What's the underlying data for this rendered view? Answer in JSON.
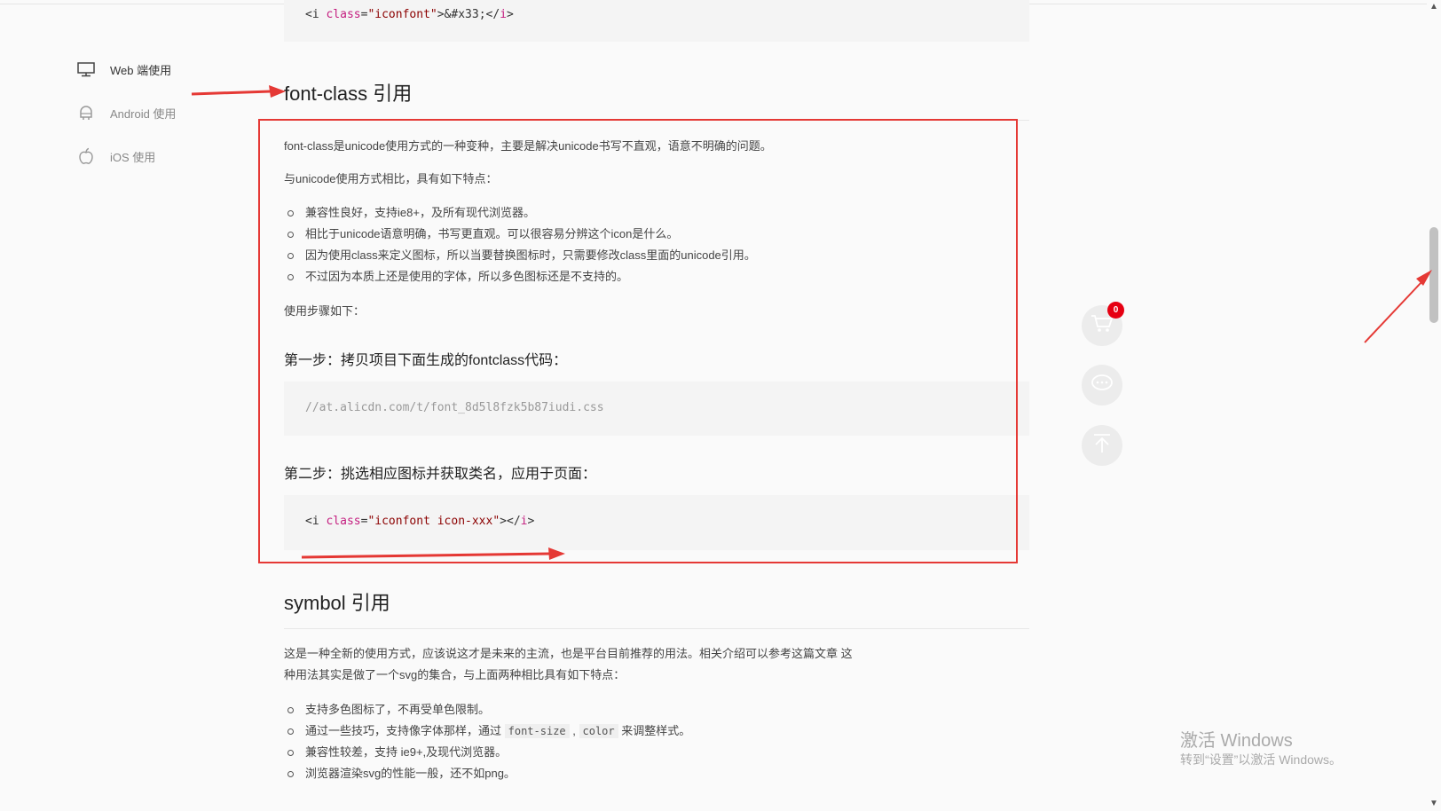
{
  "sidebar": {
    "items": [
      {
        "label": "Web 端使用",
        "icon": "monitor-icon",
        "active": true
      },
      {
        "label": "Android 使用",
        "icon": "android-icon",
        "active": false
      },
      {
        "label": "iOS 使用",
        "icon": "apple-icon",
        "active": false
      }
    ]
  },
  "top_code": {
    "tag_open": "<i ",
    "attr": "class",
    "eq": "=",
    "val": "\"iconfont\"",
    "rest": ">&#x33;</",
    "tag_close": "i",
    "end": ">"
  },
  "font_class": {
    "title": "font-class 引用",
    "intro": "font-class是unicode使用方式的一种变种，主要是解决unicode书写不直观，语意不明确的问题。",
    "compare": "与unicode使用方式相比，具有如下特点：",
    "features": [
      "兼容性良好，支持ie8+，及所有现代浏览器。",
      "相比于unicode语意明确，书写更直观。可以很容易分辨这个icon是什么。",
      "因为使用class来定义图标，所以当要替换图标时，只需要修改class里面的unicode引用。",
      "不过因为本质上还是使用的字体，所以多色图标还是不支持的。"
    ],
    "steps_intro": "使用步骤如下：",
    "step1": "第一步：拷贝项目下面生成的fontclass代码：",
    "step1_code": "//at.alicdn.com/t/font_8d5l8fzk5b87iudi.css",
    "step2": "第二步：挑选相应图标并获取类名，应用于页面：",
    "step2_code": {
      "tag_open": "<i ",
      "attr": "class",
      "eq": "=",
      "val": "\"iconfont icon-xxx\"",
      "rest": "></",
      "tag_close": "i",
      "end": ">"
    }
  },
  "symbol": {
    "title": "symbol 引用",
    "intro_line1": "这是一种全新的使用方式，应该说这才是未来的主流，也是平台目前推荐的用法。相关介绍可以参考这篇文章 这",
    "intro_line2": "种用法其实是做了一个svg的集合，与上面两种相比具有如下特点：",
    "features": [
      {
        "text": "支持多色图标了，不再受单色限制。"
      },
      {
        "pre": "通过一些技巧，支持像字体那样，通过 ",
        "code1": "font-size",
        "mid": " , ",
        "code2": "color",
        "post": " 来调整样式。"
      },
      {
        "text": "兼容性较差，支持 ie9+,及现代浏览器。"
      },
      {
        "text": "浏览器渲染svg的性能一般，还不如png。"
      }
    ]
  },
  "cart": {
    "badge": "0"
  },
  "floating": [
    "cart-icon",
    "chat-icon",
    "back-to-top-icon"
  ],
  "watermark": {
    "line1": "激活 Windows",
    "line2": "转到“设置”以激活 Windows。"
  },
  "colors": {
    "annotation_red": "#e53935",
    "badge_red": "#e60012"
  }
}
